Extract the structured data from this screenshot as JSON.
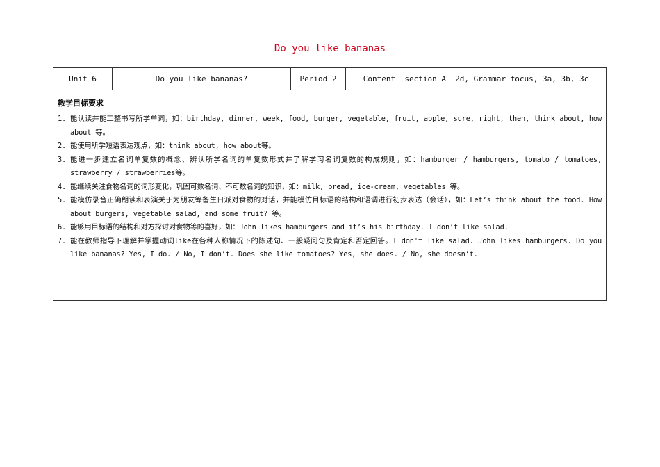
{
  "document": {
    "title": "Do you like bananas"
  },
  "header_row": {
    "unit": "Unit 6",
    "lesson_title": "Do you like bananas?",
    "period": "Period 2",
    "content": "Content  section A  2d, Grammar focus, 3a, 3b, 3c"
  },
  "objectives": {
    "heading": "教学目标要求",
    "items": [
      {
        "num": "1.",
        "text": "能认读并能工整书写所学单词，如：birthday, dinner, week, food, burger, vegetable, fruit, apple, sure, right, then, think about, how about 等。"
      },
      {
        "num": "2.",
        "text": "能使用所学短语表达观点，如：think about, how about等。"
      },
      {
        "num": "3.",
        "text": "能进一步建立名词单复数的概念、辨认所学名词的单复数形式并了解学习名词复数的构成规则，如：hamburger / hamburgers, tomato / tomatoes, strawberry / strawberries等。"
      },
      {
        "num": "4.",
        "text": "能继续关注食物名词的词形变化，巩固可数名词、不可数名词的知识，如：milk, bread, ice-cream, vegetables 等。"
      },
      {
        "num": "5.",
        "text": "能模仿录音正确朗读和表演关于为朋友筹备生日派对食物的对话，并能模仿目标语的结构和语调进行初步表达（会话），如：Let’s think about the food. How about burgers, vegetable salad, and some fruit? 等。"
      },
      {
        "num": "6.",
        "text": "能够用目标语的结构和对方探讨对食物等的喜好，如：John likes hamburgers and it’s his birthday. I don’t like salad."
      },
      {
        "num": "7.",
        "text": "能在教师指导下理解并掌握动词like在各种人称情况下的陈述句、一般疑问句及肯定和否定回答。I don't like salad. John likes hamburgers. Do you like bananas? Yes, I do. / No, I don’t. Does she like tomatoes? Yes, she does. / No, she doesn’t."
      }
    ]
  }
}
